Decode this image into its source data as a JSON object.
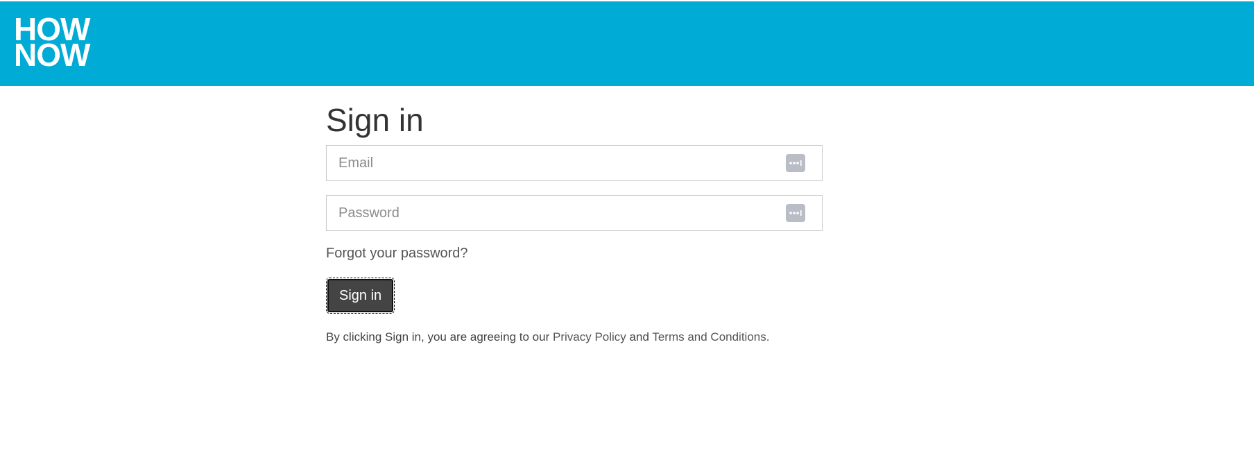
{
  "header": {
    "logo_line1": "HOW",
    "logo_line2": "NOW",
    "background_color": "#00acd6"
  },
  "form": {
    "title": "Sign in",
    "email_placeholder": "Email",
    "password_placeholder": "Password",
    "password_manager_icon": "password-manager-icon",
    "forgot_link": "Forgot your password?",
    "submit_label": "Sign in"
  },
  "legal": {
    "prefix": "By clicking Sign in, you are agreeing to our",
    "privacy_link": "Privacy Policy",
    "conjunction": "and",
    "terms_link": "Terms and Conditions",
    "suffix": "."
  }
}
